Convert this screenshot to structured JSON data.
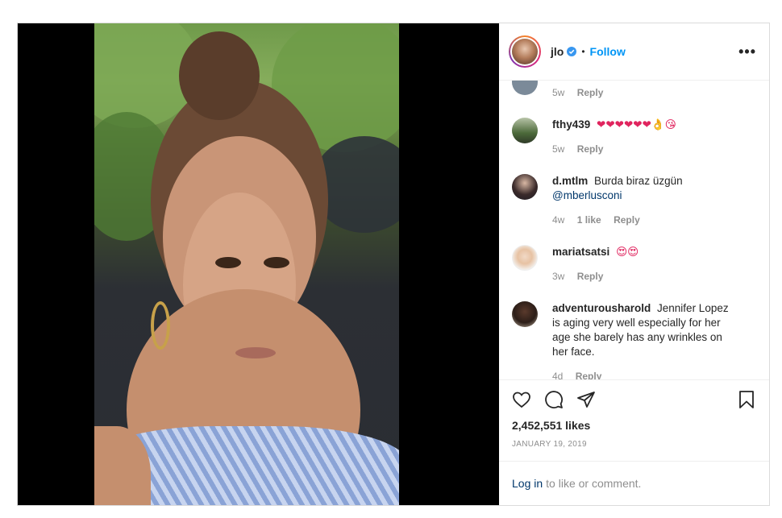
{
  "post": {
    "username": "jlo",
    "dot": "•",
    "follow_label": "Follow",
    "more_label": "•••",
    "likes": "2,452,551 likes",
    "date": "JANUARY 19, 2019"
  },
  "comments": [
    {
      "user": "",
      "text": "",
      "age": "5w",
      "likes": "",
      "reply": "Reply"
    },
    {
      "user": "fthy439",
      "text": "❤❤❤❤❤❤👌😘",
      "age": "5w",
      "likes": "",
      "reply": "Reply"
    },
    {
      "user": "d.mtlm",
      "text": "Burda biraz üzgün",
      "mention": "@mberlusconi",
      "age": "4w",
      "likes": "1 like",
      "reply": "Reply"
    },
    {
      "user": "mariatsatsi",
      "text": "😍😍",
      "age": "3w",
      "likes": "",
      "reply": "Reply"
    },
    {
      "user": "adventurousharold",
      "text": "Jennifer Lopez is aging very well especially for her age she barely has any wrinkles on her face.",
      "age": "4d",
      "likes": "",
      "reply": "Reply"
    }
  ],
  "login": {
    "link": "Log in",
    "rest": "to like or comment."
  },
  "icons": {
    "like": "heart-icon",
    "comment": "comment-icon",
    "share": "share-icon",
    "save": "bookmark-icon",
    "verified": "verified-badge-icon"
  },
  "colors": {
    "link": "#0095f6",
    "text": "#262626",
    "muted": "#8e8e8e"
  }
}
